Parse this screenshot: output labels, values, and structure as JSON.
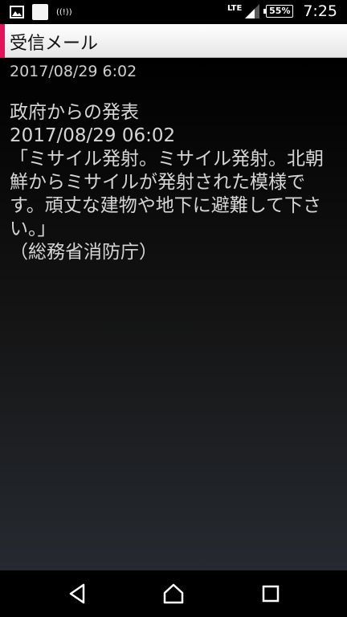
{
  "status_bar": {
    "icons_left": [
      "image-icon",
      "app-square-icon",
      "alert-icon"
    ],
    "alert_text": "((!))",
    "network": "LTE",
    "battery": "55%",
    "time": "7:25"
  },
  "title_bar": {
    "title": "受信メール",
    "accent_color": "#e4145c"
  },
  "mail": {
    "received_date": "2017/08/29 6:02",
    "message": "政府からの発表\n2017/08/29 06:02\n「ミサイル発射。ミサイル発射。北朝鮮からミサイルが発射された模様です。頑丈な建物や地下に避難して下さい。」\n（総務省消防庁）"
  },
  "nav_bar": {
    "icons": [
      "back-icon",
      "home-icon",
      "recent-apps-icon"
    ]
  }
}
